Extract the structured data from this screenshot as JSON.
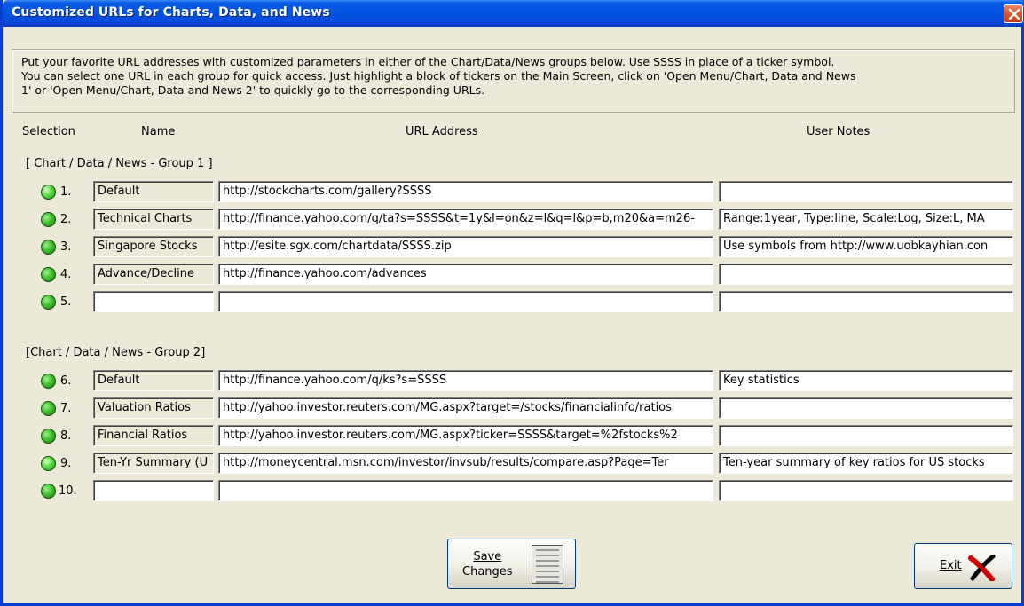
{
  "window": {
    "title": "Customized URLs for Charts, Data, and News"
  },
  "info": {
    "line1": "Put your favorite URL addresses with customized parameters in either of the Chart/Data/News groups below. Use SSSS in place of a ticker symbol.",
    "line2": "You can select one URL in each group for quick access. Just highlight a block of tickers on the Main Screen,  click on 'Open Menu/Chart, Data and News",
    "line3": "1' or 'Open Menu/Chart, Data and News 2' to quickly go to the corresponding URLs."
  },
  "headers": {
    "selection": "Selection",
    "name": "Name",
    "url": "URL Address",
    "notes": "User Notes"
  },
  "group1": {
    "label": "[ Chart / Data / News - Group 1 ]",
    "rows": [
      {
        "num": "1.",
        "name": "Default",
        "url": "http://stockcharts.com/gallery?SSSS",
        "notes": "",
        "selected": true
      },
      {
        "num": "2.",
        "name": "Technical Charts",
        "url": "http://finance.yahoo.com/q/ta?s=SSSS&t=1y&l=on&z=l&q=l&p=b,m20&a=m26-",
        "notes": "Range:1year, Type:line, Scale:Log, Size:L, MA",
        "selected": false
      },
      {
        "num": "3.",
        "name": "Singapore Stocks",
        "url": "http://esite.sgx.com/chartdata/SSSS.zip",
        "notes": "Use symbols from http://www.uobkayhian.con",
        "selected": false
      },
      {
        "num": "4.",
        "name": "Advance/Decline",
        "url": "http://finance.yahoo.com/advances",
        "notes": "",
        "selected": false
      },
      {
        "num": "5.",
        "name": "",
        "url": "",
        "notes": "",
        "selected": false
      }
    ]
  },
  "group2": {
    "label": "[Chart / Data / News - Group 2]",
    "rows": [
      {
        "num": "6.",
        "name": "Default",
        "url": "http://finance.yahoo.com/q/ks?s=SSSS",
        "notes": "Key statistics",
        "selected": false
      },
      {
        "num": "7.",
        "name": "Valuation Ratios",
        "url": "http://yahoo.investor.reuters.com/MG.aspx?target=/stocks/financialinfo/ratios",
        "notes": "",
        "selected": false
      },
      {
        "num": "8.",
        "name": "Financial Ratios",
        "url": "http://yahoo.investor.reuters.com/MG.aspx?ticker=SSSS&target=%2fstocks%2",
        "notes": "",
        "selected": false
      },
      {
        "num": "9.",
        "name": "Ten-Yr Summary (U",
        "url": "http://moneycentral.msn.com/investor/invsub/results/compare.asp?Page=Ter",
        "notes": "Ten-year summary of key ratios for US stocks",
        "selected": true
      },
      {
        "num": "10.",
        "name": "",
        "url": "",
        "notes": "",
        "selected": false
      }
    ]
  },
  "buttons": {
    "save_line1": "Save",
    "save_line2": "Changes",
    "exit": "Exit"
  },
  "icons": {
    "close": "close-icon",
    "save": "document-icon",
    "exit": "red-x-icon"
  }
}
